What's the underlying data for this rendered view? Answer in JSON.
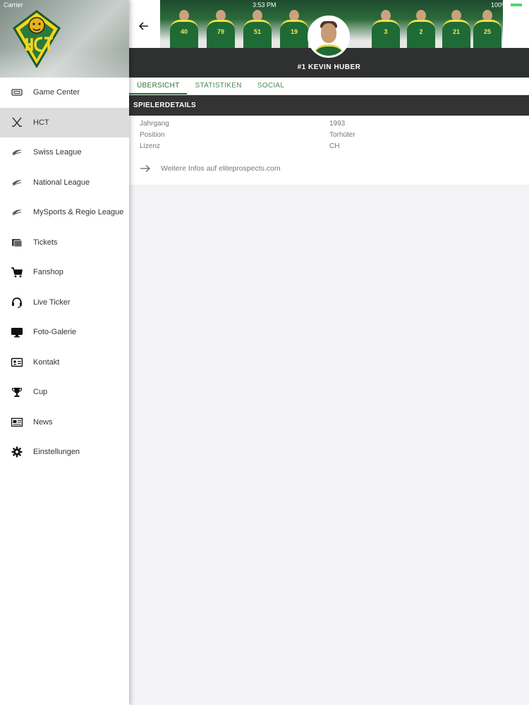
{
  "status_bar": {
    "carrier": "Carrier",
    "time": "3:53 PM",
    "battery": "100%"
  },
  "sidebar": {
    "items": [
      {
        "label": "Game Center",
        "icon": "ticket-screen-icon"
      },
      {
        "label": "HCT",
        "icon": "crossed-sticks-icon",
        "active": true
      },
      {
        "label": "Swiss League",
        "icon": "league-swoosh-icon"
      },
      {
        "label": "National League",
        "icon": "league-swoosh-icon"
      },
      {
        "label": "MySports & Regio League",
        "icon": "league-swoosh-icon"
      },
      {
        "label": "Tickets",
        "icon": "tickets-icon"
      },
      {
        "label": "Fanshop",
        "icon": "cart-icon"
      },
      {
        "label": "Live Ticker",
        "icon": "headset-icon"
      },
      {
        "label": "Foto-Galerie",
        "icon": "monitor-icon"
      },
      {
        "label": "Kontakt",
        "icon": "contact-card-icon"
      },
      {
        "label": "Cup",
        "icon": "trophy-icon"
      },
      {
        "label": "News",
        "icon": "newspaper-icon"
      },
      {
        "label": "Einstellungen",
        "icon": "gear-icon"
      }
    ]
  },
  "header": {
    "player_name": "#1 KEVIN HUBER"
  },
  "tabs": [
    {
      "label": "ÜBERSICHT",
      "active": true
    },
    {
      "label": "STATISTIKEN"
    },
    {
      "label": "SOCIAL"
    }
  ],
  "details": {
    "title": "SPIELERDETAILS",
    "rows": [
      {
        "label": "Jahrgang",
        "value": "1993"
      },
      {
        "label": "Position",
        "value": "Torhüter"
      },
      {
        "label": "Lizenz",
        "value": "CH"
      }
    ],
    "more_link": "Weitere Infos auf eliteprospects.com"
  },
  "colors": {
    "accent": "#2c6e3a",
    "dark_bar": "#333333",
    "active_bg": "#dcdcdc"
  }
}
